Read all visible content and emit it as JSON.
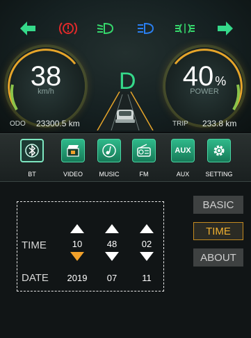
{
  "colors": {
    "accent_green": "#35d98a",
    "accent_orange": "#f0a02a",
    "teal_button": "#2fb98a",
    "brake_red": "#e02a2a",
    "lowbeam_green": "#36d86c",
    "highbeam_blue": "#2a7ff0"
  },
  "indicators": {
    "left_turn_icon": "arrow-left-icon",
    "brake_icon": "brake-warning-icon",
    "lowbeam_icon": "low-beam-icon",
    "highbeam_icon": "high-beam-icon",
    "fog_icon": "fog-light-icon",
    "right_turn_icon": "arrow-right-icon"
  },
  "speed": {
    "value": "38",
    "unit": "km/h"
  },
  "gear": "D",
  "power": {
    "value": "40",
    "percent": "%",
    "label": "POWER"
  },
  "odo": {
    "label": "ODO",
    "value": "23300.5 km"
  },
  "trip": {
    "label": "TRIP",
    "value": "233.8  km"
  },
  "menu": [
    {
      "label": "BT",
      "icon": "bluetooth-icon"
    },
    {
      "label": "VIDEO",
      "icon": "video-icon"
    },
    {
      "label": "MUSIC",
      "icon": "music-icon"
    },
    {
      "label": "FM",
      "icon": "radio-icon"
    },
    {
      "label": "AUX",
      "icon_text": "AUX"
    },
    {
      "label": "SETTING",
      "icon": "gear-icon"
    }
  ],
  "settings": {
    "time_label": "TIME",
    "date_label": "DATE",
    "time": [
      "10",
      "48",
      "02"
    ],
    "date": [
      "2019",
      "07",
      "11"
    ]
  },
  "side_buttons": {
    "basic": "BASIC",
    "time": "TIME",
    "about": "ABOUT"
  }
}
